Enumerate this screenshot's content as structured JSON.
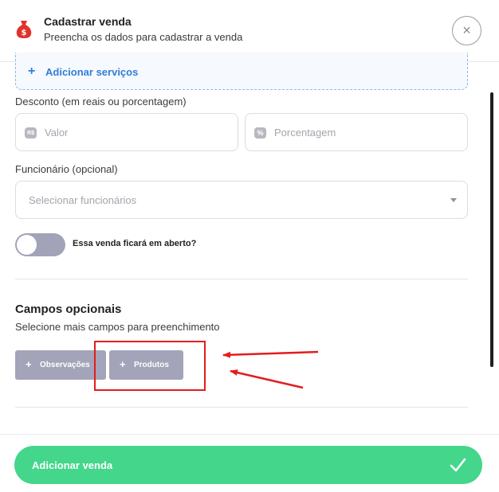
{
  "header": {
    "title": "Cadastrar venda",
    "subtitle": "Preencha os dados para cadastrar a venda",
    "icon": "money-bag-icon",
    "close_icon": "×"
  },
  "services": {
    "plus": "+",
    "label": "Adicionar serviços"
  },
  "discount": {
    "label": "Desconto (em reais ou porcentagem)",
    "value_icon": "R$",
    "value_placeholder": "Valor",
    "percent_icon": "%",
    "percent_placeholder": "Porcentagem"
  },
  "employee": {
    "label": "Funcionário (opcional)",
    "placeholder": "Selecionar funcionários"
  },
  "open_sale": {
    "label": "Essa venda ficará em aberto?",
    "enabled": false
  },
  "optional_fields": {
    "title": "Campos opcionais",
    "subtitle": "Selecione mais campos para preenchimento",
    "buttons": [
      {
        "plus": "+",
        "label": "Observações"
      },
      {
        "plus": "+",
        "label": "Produtos"
      }
    ]
  },
  "footer": {
    "submit_label": "Adicionar venda",
    "submit_icon": "check-icon"
  },
  "colors": {
    "accent_blue": "#2f7fd6",
    "submit_green": "#44d68b",
    "option_button": "#a3a4b9",
    "annotation_red": "#e31d1d",
    "bag_red": "#e0322d"
  }
}
